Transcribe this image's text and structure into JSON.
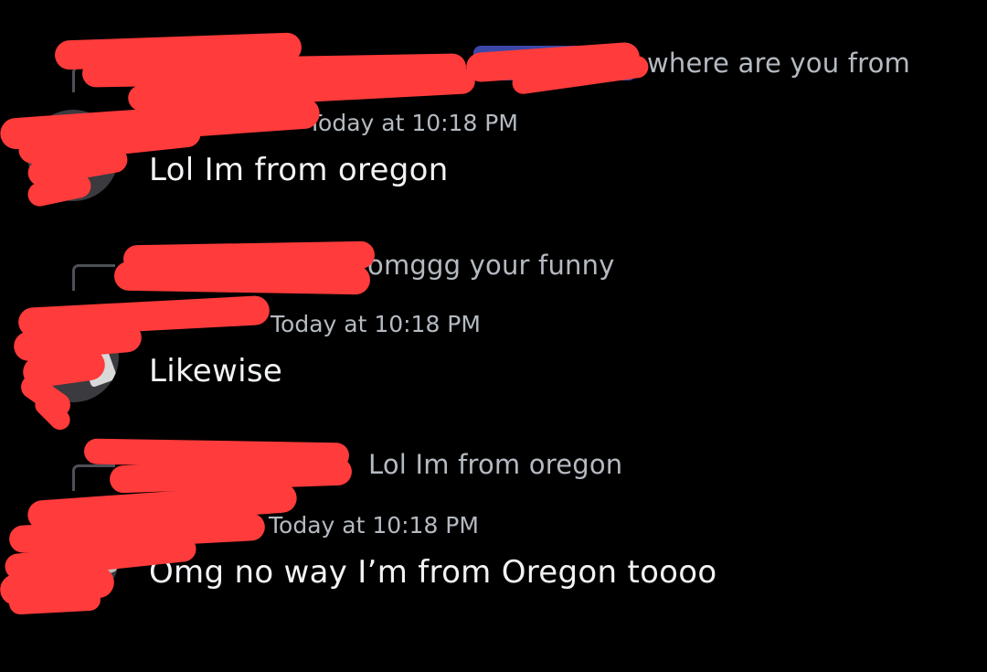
{
  "messages": [
    {
      "reply_text": "where are you from",
      "timestamp": "Today at 10:18 PM",
      "content": "Lol Im from oregon"
    },
    {
      "reply_text": "omggg your funny",
      "timestamp": "Today at 10:18 PM",
      "content": "Likewise"
    },
    {
      "reply_text": "Lol Im from oregon",
      "timestamp": "Today at 10:18 PM",
      "content": "Omg no way I’m from Oregon toooo"
    }
  ],
  "colors": {
    "background": "#000000",
    "text_primary": "#f2f3f5",
    "text_muted": "#b5bac1",
    "reply_spine": "#4e5058",
    "role_chip": "#3b48a8",
    "redaction": "#ff3b3b"
  }
}
